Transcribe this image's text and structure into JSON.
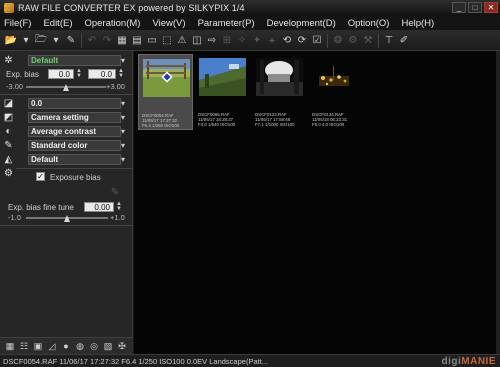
{
  "window": {
    "title": "RAW FILE CONVERTER EX powered by SILKYPIX   1/4",
    "minimize_label": "_",
    "maximize_label": "□",
    "close_label": "✕"
  },
  "menu": {
    "items": [
      "File(F)",
      "Edit(E)",
      "Operation(M)",
      "View(V)",
      "Parameter(P)",
      "Development(D)",
      "Option(O)",
      "Help(H)"
    ]
  },
  "panel": {
    "preset_value": "Default",
    "exp_bias_label": "Exp. bias",
    "exp_bias_value1": "0.0",
    "exp_bias_value2": "0.0",
    "exp_bias_min": "-3.00",
    "exp_bias_max": "+3.00",
    "exp_bias_level": 0.5,
    "wb_value": "0.0",
    "camera_setting": "Camera setting",
    "contrast": "Average contrast",
    "color": "Standard color",
    "sharpness": "Default",
    "exposure_bias_checkbox": "Exposure bias",
    "fine_tune_label": "Exp. bias fine tune",
    "fine_tune_value": "0.00",
    "fine_tune_min": "-1.0",
    "fine_tune_max": "+1.0",
    "fine_tune_level": 0.5
  },
  "thumbnails": [
    {
      "lines": [
        "DSCF0054.RAF",
        "11/06/17 17:27:32",
        "F6.4 1/250 ISO100"
      ]
    },
    {
      "lines": [
        "DSCF0066.RAF",
        "11/06/17 18:28:37",
        "F4.0 1/640 ISO100"
      ]
    },
    {
      "lines": [
        "DSCF0123.RAF",
        "11/06/17 17:58:48",
        "F7.1 1/1000 ISO100"
      ]
    },
    {
      "lines": [
        "DSCF0134.RAF",
        "11/06/18 05:23:31",
        "F5.0 4.0 ISO100"
      ]
    }
  ],
  "status": {
    "text": "DSCF0054.RAF 11/06/17 17:27:32 F6.4 1/250 ISO100  0.0EV Landscape(Patt...",
    "watermark_left": "digi",
    "watermark_right": "MANIE"
  },
  "colors": {
    "accent_green": "#6fd16f",
    "background": "#050505",
    "panel": "#262626"
  }
}
